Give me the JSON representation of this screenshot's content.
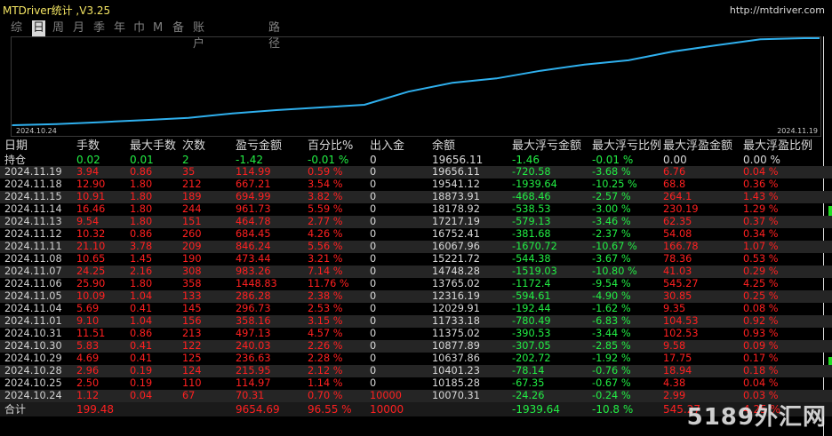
{
  "window": {
    "title": "MTDriver统计 ,V3.25",
    "url": "http://mtdriver.com"
  },
  "tabs": [
    "综",
    "日",
    "周",
    "月",
    "季",
    "年",
    "巾",
    "M",
    "备",
    "账户",
    "路径"
  ],
  "active_tab": 1,
  "chart": {
    "start_label": "2024.10.24",
    "end_label": "2024.11.19",
    "color": "#2fb0ee"
  },
  "chart_data": {
    "type": "line",
    "x": [
      "2024.10.24",
      "2024.10.25",
      "2024.10.28",
      "2024.10.29",
      "2024.10.30",
      "2024.10.31",
      "2024.11.01",
      "2024.11.04",
      "2024.11.05",
      "2024.11.06",
      "2024.11.07",
      "2024.11.08",
      "2024.11.11",
      "2024.11.12",
      "2024.11.13",
      "2024.11.14",
      "2024.11.15",
      "2024.11.18",
      "2024.11.19"
    ],
    "y": [
      10070.31,
      10185.28,
      10401.23,
      10637.86,
      10877.89,
      11375.02,
      11733.18,
      12029.91,
      12316.19,
      13765.02,
      14748.28,
      15221.72,
      16067.96,
      16752.41,
      17217.19,
      18178.92,
      18873.91,
      19541.12,
      19656.11
    ],
    "xlabel": "",
    "ylabel": ""
  },
  "table": {
    "headers": [
      "日期",
      "手数",
      "最大手数",
      "次数",
      "盈亏金额",
      "百分比%",
      "出入金",
      "余额",
      "最大浮亏金额",
      "最大浮亏比例",
      "最大浮盈金额",
      "最大浮盈比例"
    ],
    "holding": {
      "label": "持仓",
      "lots": "0.02",
      "max_lots": "0.01",
      "count": "2",
      "pnl": "-1.42",
      "pct": "-0.01 %",
      "flow": "0",
      "balance": "19656.11",
      "max_float_loss": "-1.46",
      "max_float_loss_pct": "-0.01 %",
      "max_float_profit": "0.00",
      "max_float_profit_pct": "0.00 %"
    },
    "rows": [
      [
        "2024.11.19",
        "3.94",
        "0.86",
        "35",
        "114.99",
        "0.59 %",
        "0",
        "19656.11",
        "-720.58",
        "-3.68 %",
        "6.76",
        "0.04 %"
      ],
      [
        "2024.11.18",
        "12.90",
        "1.80",
        "212",
        "667.21",
        "3.54 %",
        "0",
        "19541.12",
        "-1939.64",
        "-10.25 %",
        "68.8",
        "0.36 %"
      ],
      [
        "2024.11.15",
        "10.91",
        "1.80",
        "189",
        "694.99",
        "3.82 %",
        "0",
        "18873.91",
        "-468.46",
        "-2.57 %",
        "264.1",
        "1.43 %"
      ],
      [
        "2024.11.14",
        "16.46",
        "1.80",
        "244",
        "961.73",
        "5.59 %",
        "0",
        "18178.92",
        "-538.53",
        "-3.00 %",
        "230.19",
        "1.29 %"
      ],
      [
        "2024.11.13",
        "9.54",
        "1.80",
        "151",
        "464.78",
        "2.77 %",
        "0",
        "17217.19",
        "-579.13",
        "-3.46 %",
        "62.35",
        "0.37 %"
      ],
      [
        "2024.11.12",
        "10.32",
        "0.86",
        "260",
        "684.45",
        "4.26 %",
        "0",
        "16752.41",
        "-381.68",
        "-2.37 %",
        "54.08",
        "0.34 %"
      ],
      [
        "2024.11.11",
        "21.10",
        "3.78",
        "209",
        "846.24",
        "5.56 %",
        "0",
        "16067.96",
        "-1670.72",
        "-10.67 %",
        "166.78",
        "1.07 %"
      ],
      [
        "2024.11.08",
        "10.65",
        "1.45",
        "190",
        "473.44",
        "3.21 %",
        "0",
        "15221.72",
        "-544.38",
        "-3.67 %",
        "78.36",
        "0.53 %"
      ],
      [
        "2024.11.07",
        "24.25",
        "2.16",
        "308",
        "983.26",
        "7.14 %",
        "0",
        "14748.28",
        "-1519.03",
        "-10.80 %",
        "41.03",
        "0.29 %"
      ],
      [
        "2024.11.06",
        "25.90",
        "1.80",
        "358",
        "1448.83",
        "11.76 %",
        "0",
        "13765.02",
        "-1172.4",
        "-9.54 %",
        "545.27",
        "4.25 %"
      ],
      [
        "2024.11.05",
        "10.09",
        "1.04",
        "133",
        "286.28",
        "2.38 %",
        "0",
        "12316.19",
        "-594.61",
        "-4.90 %",
        "30.85",
        "0.25 %"
      ],
      [
        "2024.11.04",
        "5.69",
        "0.41",
        "145",
        "296.73",
        "2.53 %",
        "0",
        "12029.91",
        "-192.44",
        "-1.62 %",
        "9.35",
        "0.08 %"
      ],
      [
        "2024.11.01",
        "9.10",
        "1.04",
        "156",
        "358.16",
        "3.15 %",
        "0",
        "11733.18",
        "-780.49",
        "-6.83 %",
        "104.53",
        "0.92 %"
      ],
      [
        "2024.10.31",
        "11.51",
        "0.86",
        "213",
        "497.13",
        "4.57 %",
        "0",
        "11375.02",
        "-390.53",
        "-3.44 %",
        "102.53",
        "0.93 %"
      ],
      [
        "2024.10.30",
        "5.83",
        "0.41",
        "122",
        "240.03",
        "2.26 %",
        "0",
        "10877.89",
        "-307.05",
        "-2.85 %",
        "9.58",
        "0.09 %"
      ],
      [
        "2024.10.29",
        "4.69",
        "0.41",
        "125",
        "236.63",
        "2.28 %",
        "0",
        "10637.86",
        "-202.72",
        "-1.92 %",
        "17.75",
        "0.17 %"
      ],
      [
        "2024.10.28",
        "2.96",
        "0.19",
        "124",
        "215.95",
        "2.12 %",
        "0",
        "10401.23",
        "-78.14",
        "-0.76 %",
        "18.94",
        "0.18 %"
      ],
      [
        "2024.10.25",
        "2.50",
        "0.19",
        "110",
        "114.97",
        "1.14 %",
        "0",
        "10185.28",
        "-67.35",
        "-0.67 %",
        "4.38",
        "0.04 %"
      ],
      [
        "2024.10.24",
        "1.12",
        "0.04",
        "67",
        "70.31",
        "0.70 %",
        "10000",
        "10070.31",
        "-24.26",
        "-0.24 %",
        "2.99",
        "0.03 %"
      ]
    ],
    "total": {
      "label": "合计",
      "lots": "199.48",
      "pnl": "9654.69",
      "pct": "96.55 %",
      "flow": "10000",
      "max_float_loss": "-1939.64",
      "max_float_loss_pct": "-10.8 %",
      "max_float_profit": "545.27",
      "max_float_profit_pct": "4.25 %"
    }
  },
  "watermark": "5189外汇网"
}
